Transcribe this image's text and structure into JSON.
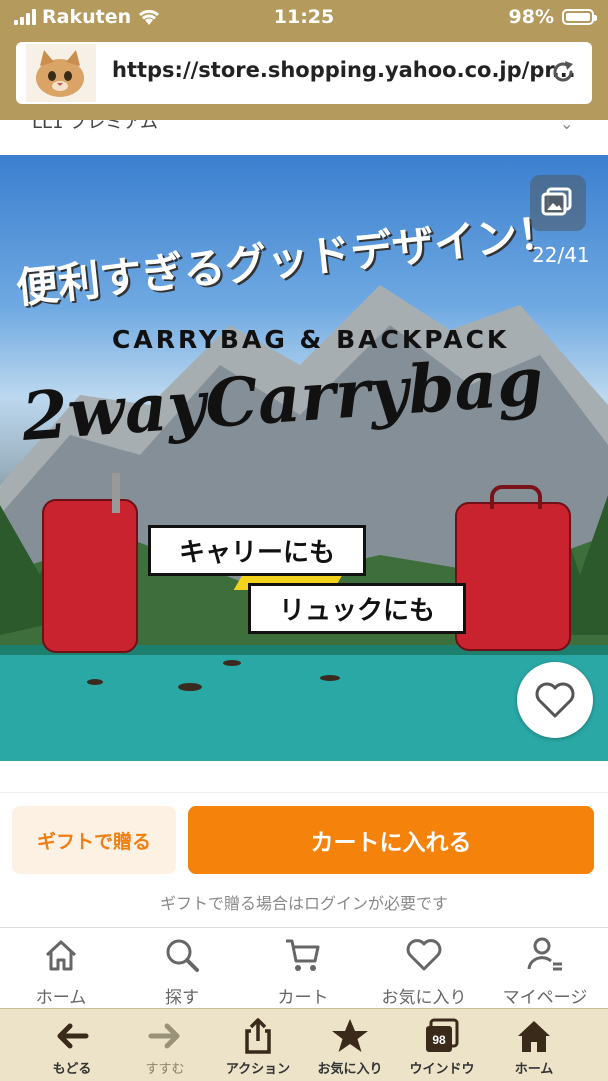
{
  "status_bar": {
    "carrier": "Rakuten",
    "time": "11:25",
    "battery": "98%"
  },
  "browser": {
    "url": "https://store.shopping.yahoo.co.jp/pr..."
  },
  "partial_row": {
    "text": "LL1 プレミアム"
  },
  "hero": {
    "headline": "便利すぎるグッドデザイン！",
    "subtitle": "CARRYBAG & BACKPACK",
    "title": "2wayCarrybag",
    "tag_carry": "キャリーにも",
    "tag_backpack": "リュックにも",
    "counter": "22/41"
  },
  "cta": {
    "gift_label": "ギフトで贈る",
    "cart_label": "カートに入れる",
    "note": "ギフトで贈る場合はログインが必要です"
  },
  "app_nav": [
    {
      "label": "ホーム",
      "icon": "home-outline-icon"
    },
    {
      "label": "探す",
      "icon": "search-icon"
    },
    {
      "label": "カート",
      "icon": "cart-icon"
    },
    {
      "label": "お気に入り",
      "icon": "heart-icon"
    },
    {
      "label": "マイページ",
      "icon": "user-icon"
    }
  ],
  "browser_toolbar": [
    {
      "label": "もどる",
      "icon": "arrow-left-icon"
    },
    {
      "label": "すすむ",
      "icon": "arrow-right-icon"
    },
    {
      "label": "アクション",
      "icon": "share-icon"
    },
    {
      "label": "お気に入り",
      "icon": "star-icon"
    },
    {
      "label": "ウインドウ",
      "icon": "windows-icon",
      "badge": "98"
    },
    {
      "label": "ホーム",
      "icon": "home-filled-icon"
    }
  ],
  "colors": {
    "browser_chrome": "#b59a5e",
    "cart_button": "#f5820a",
    "gift_button_bg": "#fdf1e4",
    "gift_button_text": "#f07e10",
    "toolbar_bg": "#ece3c9"
  }
}
